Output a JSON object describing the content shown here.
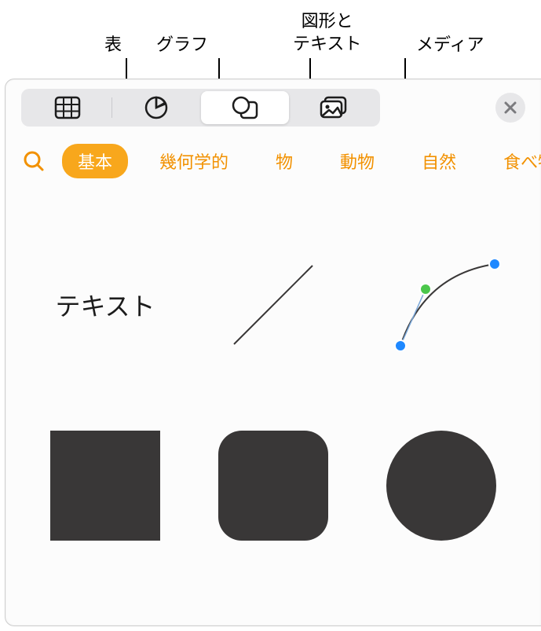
{
  "callouts": {
    "table": "表",
    "chart": "グラフ",
    "shapes_text": "図形と\nテキスト",
    "media": "メディア"
  },
  "toolbar": {
    "table_icon": "table-icon",
    "chart_icon": "chart-icon",
    "shapes_icon": "shapes-icon",
    "media_icon": "media-icon",
    "close_icon": "close-icon"
  },
  "categories": [
    {
      "label": "基本",
      "selected": true
    },
    {
      "label": "幾何学的",
      "selected": false
    },
    {
      "label": "物",
      "selected": false
    },
    {
      "label": "動物",
      "selected": false
    },
    {
      "label": "自然",
      "selected": false
    },
    {
      "label": "食べ物",
      "selected": false
    }
  ],
  "shapes": {
    "text_label": "テキスト"
  },
  "colors": {
    "accent": "#f29100",
    "accent_fill": "#f8a71c",
    "shape_fill": "#393737",
    "seg_bg": "#e7e7e9"
  }
}
